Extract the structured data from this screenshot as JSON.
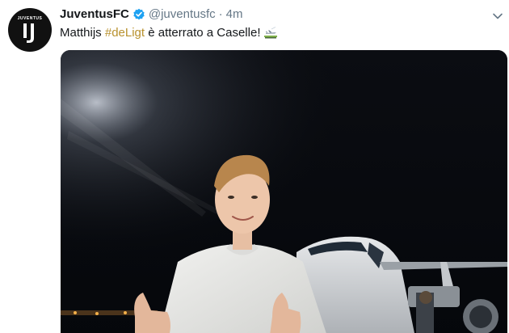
{
  "account": {
    "name": "JuventusFC",
    "handle": "@juventusfc",
    "separator": "·",
    "timestamp": "4m",
    "avatar_text": "JUVENTUS"
  },
  "tweet": {
    "text_prefix": "Matthijs ",
    "hashtag": "#deLigt",
    "text_suffix": " è atterrato a Caselle!"
  },
  "icons": {
    "verified": "verified-badge-icon",
    "caret": "chevron-down-icon",
    "emoji": "airplane-landing-emoji-icon"
  },
  "colors": {
    "verified": "#1da1f2",
    "hashtag": "#b8912e",
    "muted": "#657786"
  }
}
